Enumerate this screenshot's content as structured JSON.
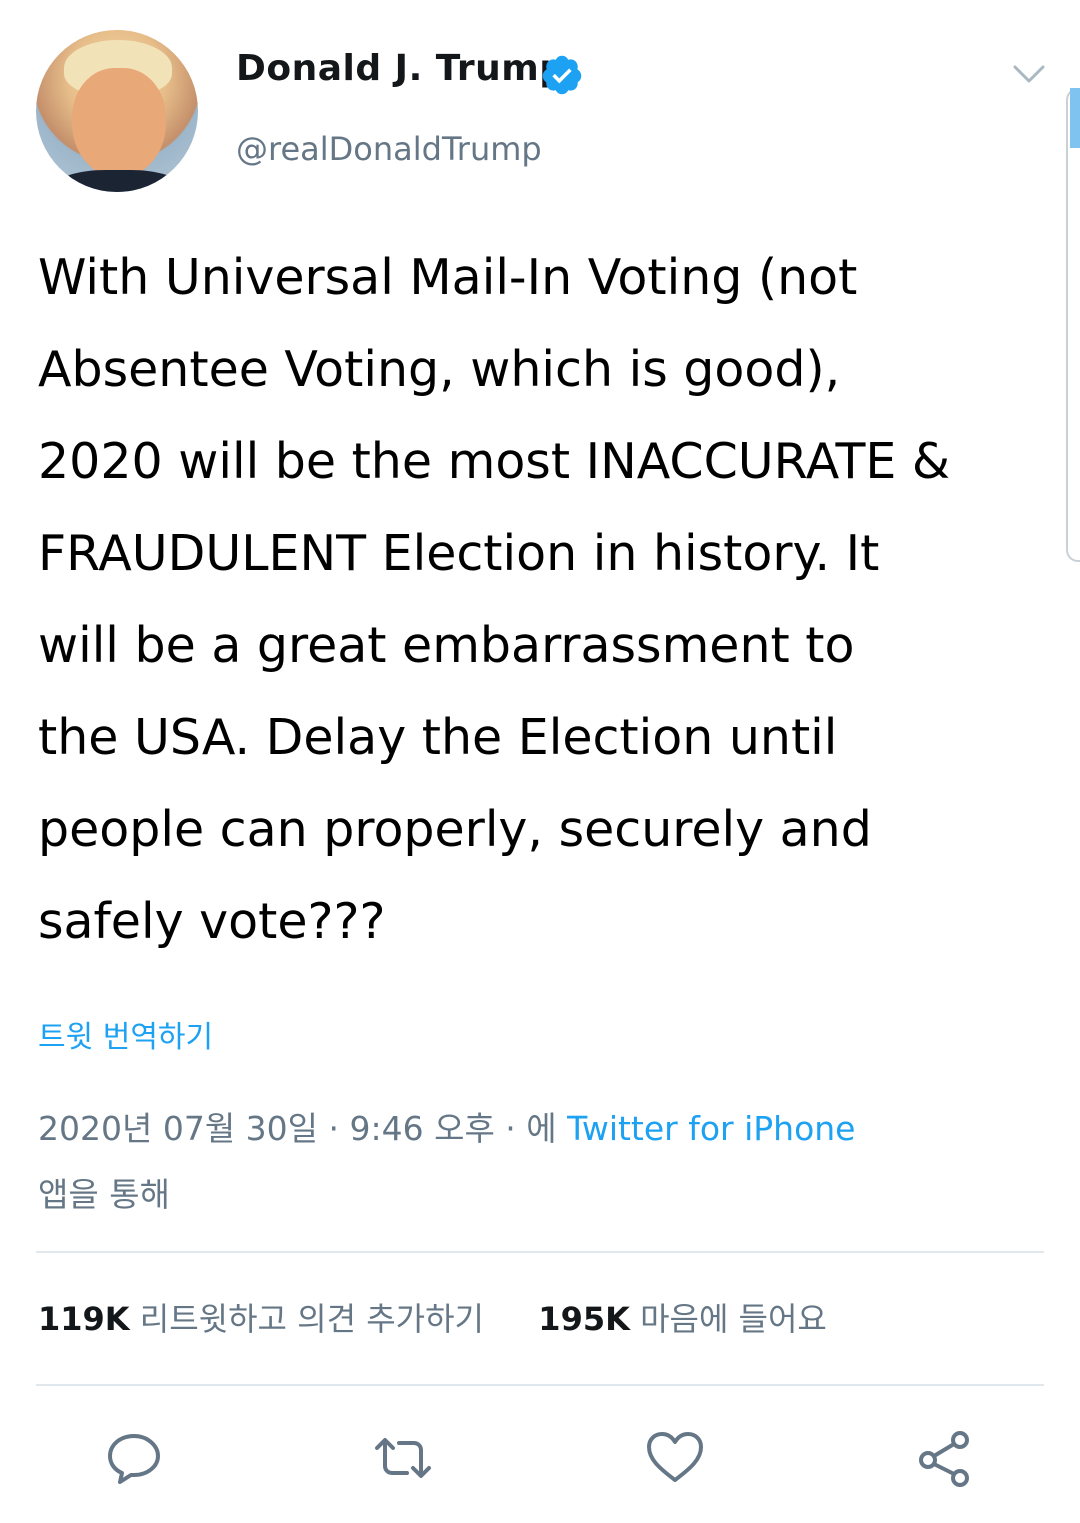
{
  "author": {
    "name": "Donald J. Trump",
    "handle": "@realDonaldTrump"
  },
  "tweet": {
    "text": "With Universal Mail-In Voting (not\nAbsentee Voting, which is good),\n2020 will be the most INACCURATE &\nFRAUDULENT Election in history. It\nwill be a great embarrassment to\nthe USA. Delay the Election until\npeople can properly, securely and\nsafely vote???",
    "translate_label": "트윗 번역하기",
    "timestamp": "2020년 07월 30일 · 9:46 오후 · 에",
    "source_label": "Twitter for iPhone",
    "via_label": "앱을 통해"
  },
  "stats": {
    "retweets_count": "119K",
    "retweets_label": "리트윗하고 의견 추가하기",
    "likes_count": "195K",
    "likes_label": "마음에 들어요"
  },
  "icons": {
    "reply": "reply-icon",
    "retweet": "retweet-icon",
    "like": "heart-icon",
    "share": "share-icon",
    "verified": "verified-badge-icon",
    "menu": "chevron-down-icon"
  },
  "colors": {
    "accent": "#1da1f2",
    "secondary_text": "#657786",
    "icon": "#657786",
    "divider": "#e1e8ed"
  }
}
